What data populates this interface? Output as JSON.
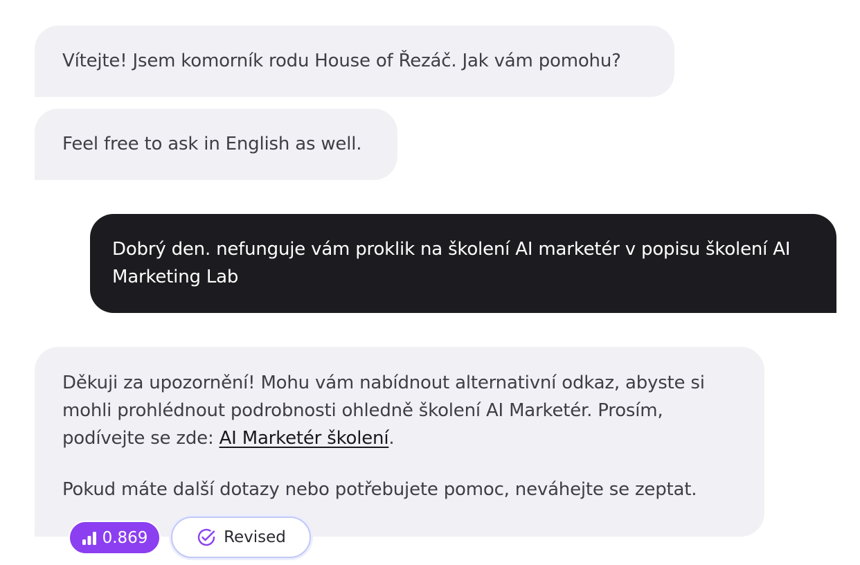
{
  "conversation": {
    "messages": [
      {
        "role": "assistant",
        "text": "Vítejte! Jsem komorník rodu House of Řezáč. Jak vám pomohu?"
      },
      {
        "role": "assistant",
        "text": "Feel free to ask in English as well."
      },
      {
        "role": "user",
        "text": "Dobrý den. nefunguje vám proklik na školení AI marketér v popisu školení AI Marketing Lab"
      },
      {
        "role": "assistant",
        "paragraph1_before_link": "Děkuji za upozornění! Mohu vám nabídnout alternativní odkaz, abyste si mohli prohlédnout podrobnosti ohledně školení AI Marketér. Prosím, podívejte se zde: ",
        "link_text": "AI Marketér školení",
        "paragraph1_after_link": ".",
        "paragraph2": "Pokud máte další dotazy nebo potřebujete pomoc, neváhejte se zeptat."
      }
    ]
  },
  "badges": {
    "score": {
      "value": "0.869",
      "icon": "bar-chart-icon",
      "color": "#8b3ff0"
    },
    "status": {
      "label": "Revised",
      "icon": "check-circle-icon",
      "color": "#8b3ff0"
    }
  },
  "colors": {
    "assistant_bubble": "#f1f0f5",
    "user_bubble": "#1c1b1f",
    "assistant_text": "#3f3d45",
    "user_text": "#ffffff"
  }
}
